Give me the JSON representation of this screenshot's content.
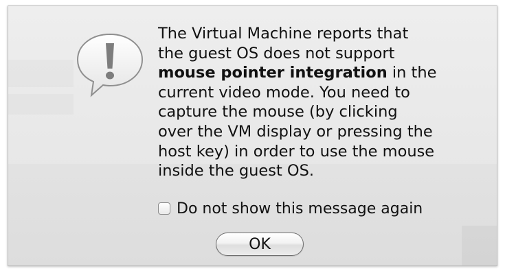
{
  "dialog": {
    "message_lines": [
      "The Virtual Machine reports that",
      "the guest OS does not support",
      [
        "mouse pointer integration",
        " in the"
      ],
      "current video mode. You need to",
      "capture the mouse (by clicking",
      "over the VM display or pressing the",
      "host key) in order to use the mouse",
      "inside the guest OS."
    ],
    "message": {
      "line1": "The Virtual Machine reports that",
      "line2": "the guest OS does not support",
      "line3_bold": "mouse pointer integration",
      "line3_rest": " in the",
      "line4": "current video mode. You need to",
      "line5": "capture the mouse (by clicking",
      "line6": "over the VM display or pressing the",
      "line7": "host key) in order to use the mouse",
      "line8": "inside the guest OS."
    },
    "checkbox": {
      "label": "Do not show this message again",
      "checked": false
    },
    "ok_label": "OK",
    "icon": "exclamation-speech-bubble-icon"
  }
}
